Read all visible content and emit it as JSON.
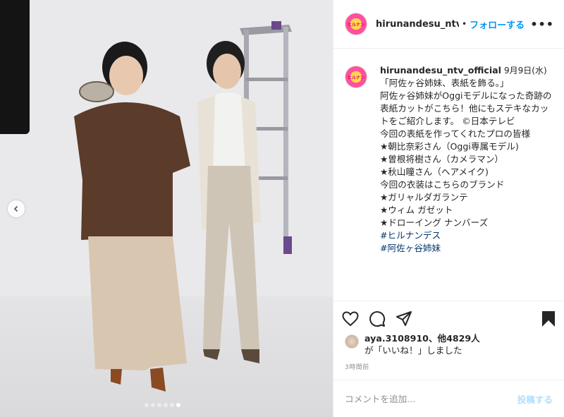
{
  "post": {
    "username": "hirunandesu_ntv_official",
    "header_username": "hirunandesu_ntv_o…",
    "follow_label": "フォローする",
    "more_label": "•••",
    "avatar_text": "ヒルナン",
    "date": "9月9日(水)",
    "caption_lines": [
      "「阿佐ヶ谷姉妹、表紙を飾る。」",
      "阿佐ヶ谷姉妹がOggiモデルになった奇跡の表紙カットがこちら！他にもステキなカットをご紹介します。 ©日本テレビ",
      "",
      "今回の表紙を作ってくれたプロの皆様",
      "★朝比奈彩さん（Oggi専属モデル)",
      "★曽根将樹さん（カメラマン）",
      "★秋山瞳さん（ヘアメイク)",
      "",
      "今回の衣装はこちらのブランド",
      "★ガリャルダガランテ",
      "★ウィム ガゼット",
      "★ドローイング ナンバーズ",
      ""
    ],
    "hashtags": [
      "#ヒルナンデス",
      "#阿佐ヶ谷姉妹"
    ],
    "likes": {
      "names": "aya.3108910、他4829人",
      "suffix_prefix": "が",
      "suffix": "「いいね！」しました"
    },
    "time_ago": "3時間前",
    "comment_placeholder": "コメントを追加...",
    "post_button": "投稿する"
  },
  "carousel": {
    "slide_count": 6,
    "active_index": 5
  },
  "icons": [
    "heart-icon",
    "comment-icon",
    "share-icon",
    "bookmark-icon",
    "chevron-left-icon"
  ],
  "colors": {
    "accent": "#0095f6",
    "post_disabled": "#b2dffc",
    "hashtag": "#00376b",
    "muted": "#8e8e8e"
  }
}
